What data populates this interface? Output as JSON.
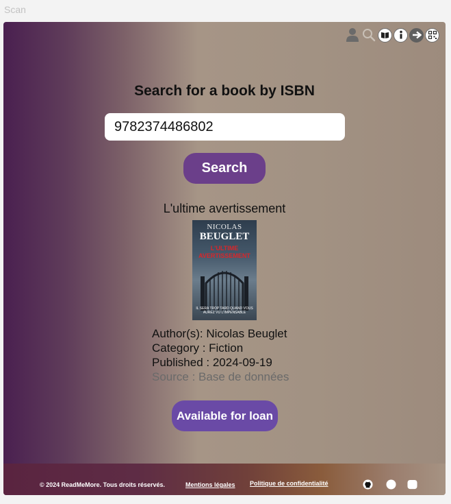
{
  "window": {
    "title": "Scan"
  },
  "toolbar": {
    "icons": [
      "user-icon",
      "search-icon",
      "book-icon",
      "info-icon",
      "arrow-right-icon",
      "qr-code-icon"
    ]
  },
  "search": {
    "heading": "Search for a book by ISBN",
    "isbn_value": "9782374486802",
    "button_label": "Search"
  },
  "book": {
    "title": "L'ultime avertissement",
    "cover": {
      "author_first": "NICOLAS",
      "author_last": "BEUGLET",
      "title": "L'ULTIME AVERTISSEMENT",
      "tagline": "IL SERA TROP TARD QUAND VOUS AUREZ VU L'IMPENSABLE"
    },
    "authors": "Author(s): Nicolas Beuglet",
    "category": "Category : Fiction",
    "published": "Published : 2024-09-19",
    "source": "Source : Base de données",
    "loan_button": "Available for loan"
  },
  "footer": {
    "copyright": "© 2024 ReadMeMore. Tous droits réservés.",
    "legal_link": "Mentions légales",
    "privacy_link": "Politique de confidentialité",
    "social_icons": [
      "github-icon",
      "circle-icon",
      "message-icon"
    ]
  },
  "colors": {
    "search_button": "#6b3f8a",
    "loan_button": "#6a4aa6",
    "gradient_start": "#4a2050",
    "gradient_end": "#9d8b7d"
  }
}
